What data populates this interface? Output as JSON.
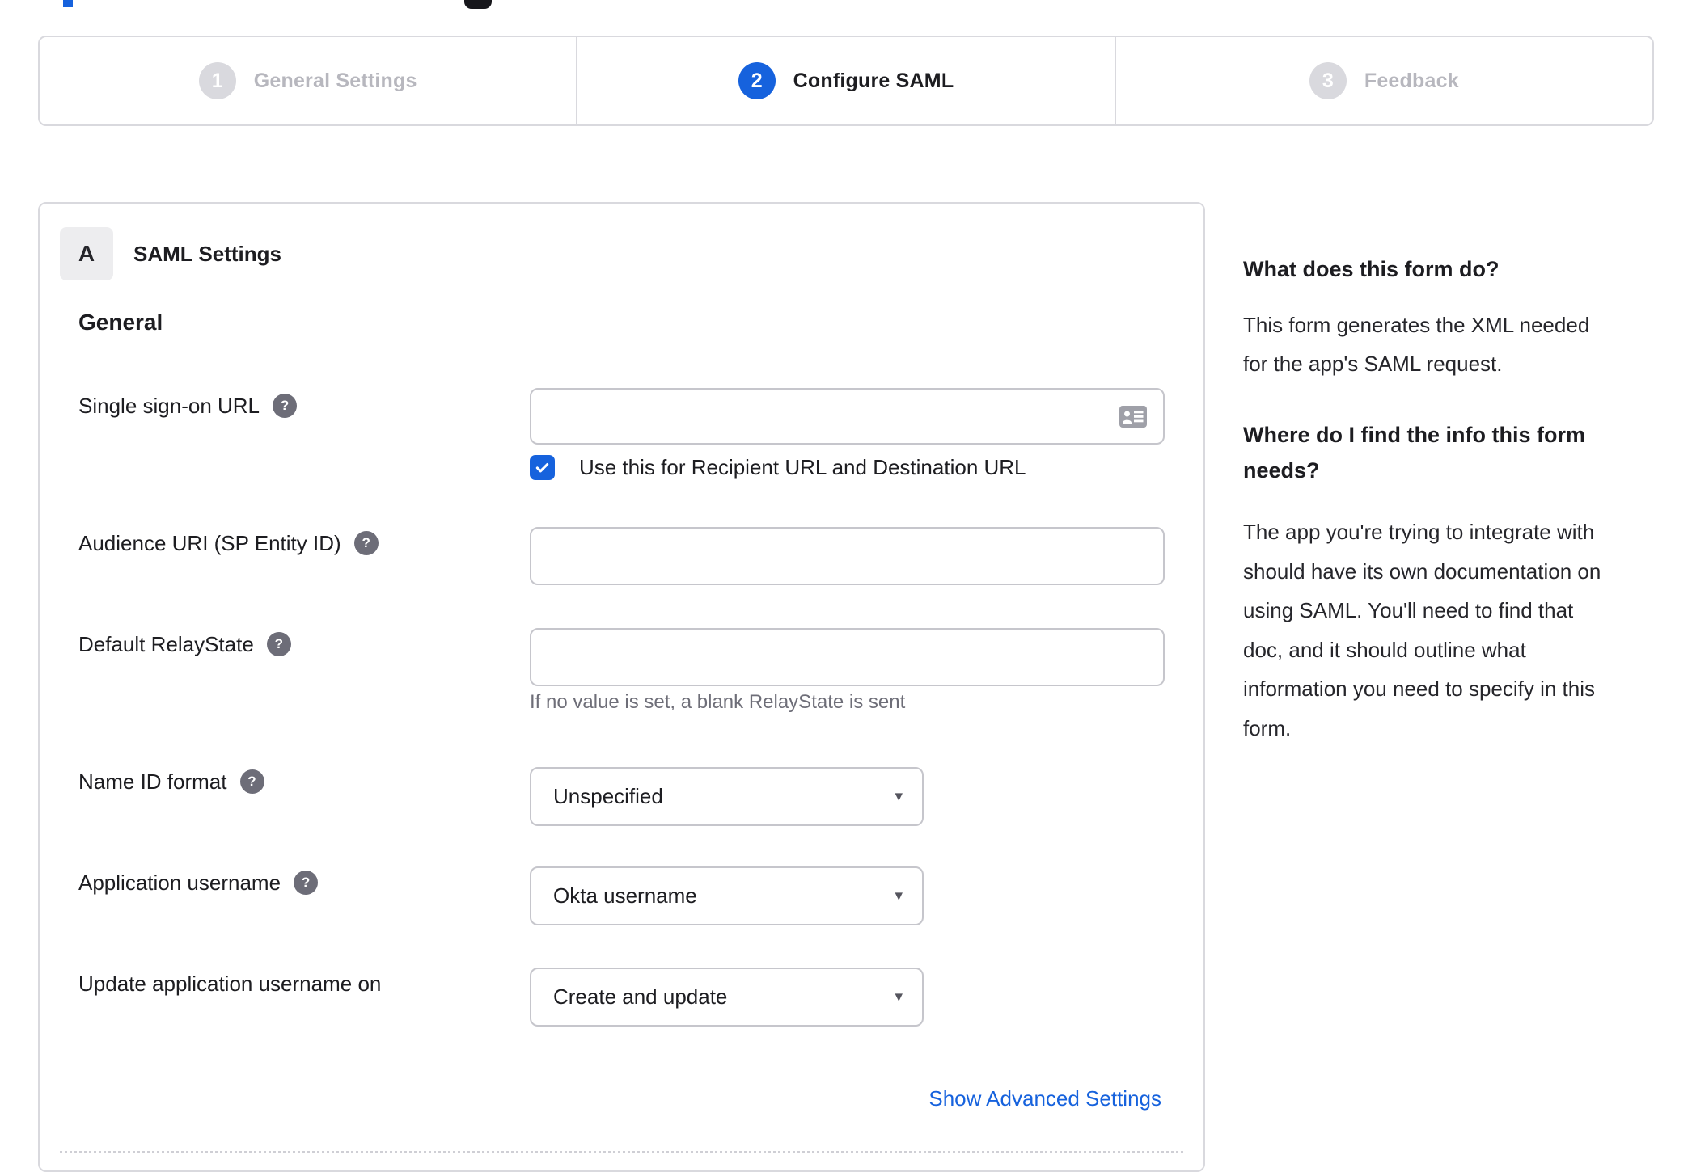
{
  "stepper": {
    "steps": [
      {
        "number": "1",
        "label": "General Settings",
        "state": "inactive"
      },
      {
        "number": "2",
        "label": "Configure SAML",
        "state": "active"
      },
      {
        "number": "3",
        "label": "Feedback",
        "state": "inactive"
      }
    ]
  },
  "panel": {
    "section_badge": "A",
    "section_title": "SAML Settings",
    "group_heading": "General",
    "fields": {
      "sso_url": {
        "label": "Single sign-on URL",
        "value": "",
        "trailing_icon": "contact-card-icon",
        "checkbox_label": "Use this for Recipient URL and Destination URL",
        "checkbox_checked": true
      },
      "audience_uri": {
        "label": "Audience URI (SP Entity ID)",
        "value": ""
      },
      "relay_state": {
        "label": "Default RelayState",
        "value": "",
        "helper": "If no value is set, a blank RelayState is sent"
      },
      "name_id_format": {
        "label": "Name ID format",
        "value": "Unspecified"
      },
      "app_username": {
        "label": "Application username",
        "value": "Okta username"
      },
      "update_app_username": {
        "label": "Update application username on",
        "value": "Create and update"
      }
    },
    "advanced_link": "Show Advanced Settings"
  },
  "sidebar": {
    "q1": "What does this form do?",
    "a1": "This form generates the XML needed\nfor the app's SAML request.",
    "q2": "Where do I find the info this form\nneeds?",
    "a2": "The app you're trying to integrate with\nshould have its own documentation on\nusing SAML. You'll need to find that\ndoc, and it should outline what\ninformation you need to specify in this\nform."
  },
  "colors": {
    "accent_blue": "#1662dd",
    "text_dark": "#1d1d21",
    "inactive_grey": "#b7b7be",
    "border_grey": "#d9d9de",
    "helper_grey": "#6e6e78"
  }
}
